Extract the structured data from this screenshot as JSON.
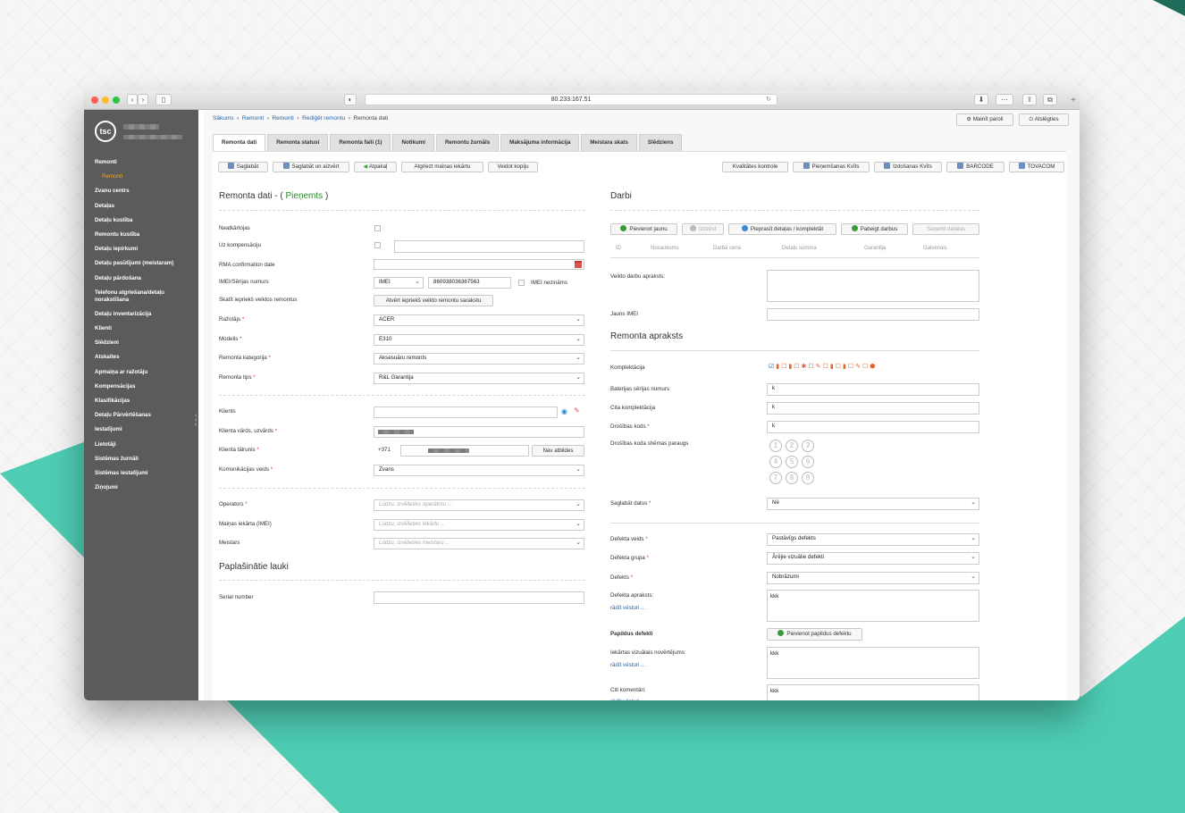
{
  "browser": {
    "url": "80.233.167.51"
  },
  "sidebar": {
    "items": [
      "Remonti",
      "Remonti",
      "Zvanu centrs",
      "Detaļas",
      "Detaļu kustība",
      "Remontu kustība",
      "Detaļu iepirkumi",
      "Detaļu pasūtījumi (meistaram)",
      "Detaļu pārdošana",
      "Telefonu atgriešana/detaļu norakstīšana",
      "Detaļu inventarizācija",
      "Klienti",
      "Slēdzieni",
      "Atskaites",
      "Apmaiņa ar ražotāju",
      "Kompensācijas",
      "Klasifikācijas",
      "Detaļu Pārvērtēšanas",
      "Iestatījumi",
      "Lietotāji",
      "Sistēmas žurnāli",
      "Sistēmas iestatījumi",
      "Ziņojumi"
    ]
  },
  "breadcrumb": {
    "b0": "Sākums",
    "b1": "Remonti",
    "b2": "Remonti",
    "b3": "Rediģēt remontu",
    "b4": "Remonta dati"
  },
  "topbar": {
    "change_password": "Mainīt paroli",
    "logout": "Atslēgties"
  },
  "tabs": [
    "Remonta dati",
    "Remonta statusi",
    "Remonta faili (1)",
    "Notikumi",
    "Remontu žurnāls",
    "Maksājuma informācija",
    "Meistara skats",
    "Slēdziens"
  ],
  "toolbar": {
    "save": "Saglabāt",
    "save_close": "Saglabāt un aizvērt",
    "back": "Atpakaļ",
    "return_device": "Atgriezt maiņas iekārtu",
    "print_copy": "Veidot kopiju",
    "quality": "Kvalitātes kontrole",
    "receipt": "Pieņemšanas Kvīts",
    "issue": "Izdošanas Kvīts",
    "barcode": "BARCODE",
    "tovacom": "TOVACOM"
  },
  "left": {
    "title": "Remonta dati - (",
    "status": "Pieņemts",
    "title_end": ")",
    "neatkartojas": "Neatkārtojas",
    "uz_komp": "Uz kompensāciju",
    "rma": "RMA confirmation date",
    "imei_label": "IMEI/Sērijas numurs",
    "imei_type": "IMEI",
    "imei_value": "860938036367563",
    "imei_unknown": "IMEI nezināms",
    "previous": "Skatīt iepriekš veiktos remontus",
    "previous_btn": "Atvērt iepriekš veikto remontu sarakstu",
    "manufacturer": "Ražotājs",
    "manufacturer_v": "ACER",
    "model": "Modelis",
    "model_v": "E310",
    "category": "Remonta kategorija",
    "category_v": "Aksesuāru remonts",
    "type": "Remonta tips",
    "type_v": "R&L Garantija",
    "client": "Klients",
    "client_name": "Klienta vārds, uzvārds",
    "client_phone": "Klienta tālrunis",
    "phone_prefix": "+371",
    "no_answer": "Nav atbildes",
    "comm": "Komunikācijas veids",
    "comm_v": "Zvans",
    "operator": "Operators",
    "operator_ph": "Lūdzu, izvēlieties operātoru ...",
    "exchange": "Maiņas iekārta (IMEI)",
    "exchange_ph": "Lūdzu, izvēlieties iekārtu ...",
    "master": "Meistars",
    "master_ph": "Lūdzu, izvēlieties meistaru ...",
    "ext_title": "Paplašinātie lauki",
    "serial": "Serial number"
  },
  "right": {
    "works_title": "Darbi",
    "add_new": "Pievienot jaunu",
    "delete": "Izdzēst",
    "order_parts": "Pieprasīt detaļas / komplektāt",
    "finish": "Pabeigt darbus",
    "get_parts": "Saņemt detaļas",
    "cols": [
      "ID",
      "Nosaukums",
      "Darbā cena",
      "Detaļu summa",
      "Garantija",
      "Galvenais"
    ],
    "works_desc": "Veikto darbu apraksts:",
    "new_imei": "Jauns IMEI",
    "desc_title": "Remonta apraksts",
    "kit": "Komplektācija",
    "battery": "Baterijas sērijas numurs",
    "battery_v": "k",
    "other_kit": "Cita komplektācija",
    "other_kit_v": "k",
    "sec_code": "Drošības kods",
    "sec_code_v": "k",
    "sec_pattern": "Drošības koda shēmas paraugs",
    "pattern": [
      "1",
      "2",
      "3",
      "4",
      "5",
      "6",
      "7",
      "8",
      "9"
    ],
    "save_data": "Saglabāt datus",
    "save_data_v": "Nē",
    "defect_type": "Defekta veids",
    "defect_type_v": "Pastāvīgs defekts",
    "defect_group": "Defekta grupa",
    "defect_group_v": "Ārējie vizuālie defekti",
    "defect": "Defekts",
    "defect_v": "Nobrāzumi",
    "defect_desc": "Defekta apraksts:",
    "defect_desc_v": "kkk",
    "show_history": "rādīt vēsturi ...",
    "extra_defects": "Papildus defekti",
    "add_extra": "Pievienot papildus defektu",
    "visual": "Iekārtas vizuālais novērtējums:",
    "visual_v": "kkk",
    "comments": "Citi komentāri:",
    "comments_v": "kkk"
  },
  "colors": {
    "accent_teal": "#4ecdb4",
    "sidebar": "#5b5b5b",
    "status_green": "#2a8a2a",
    "active_sub": "#f5a623"
  }
}
